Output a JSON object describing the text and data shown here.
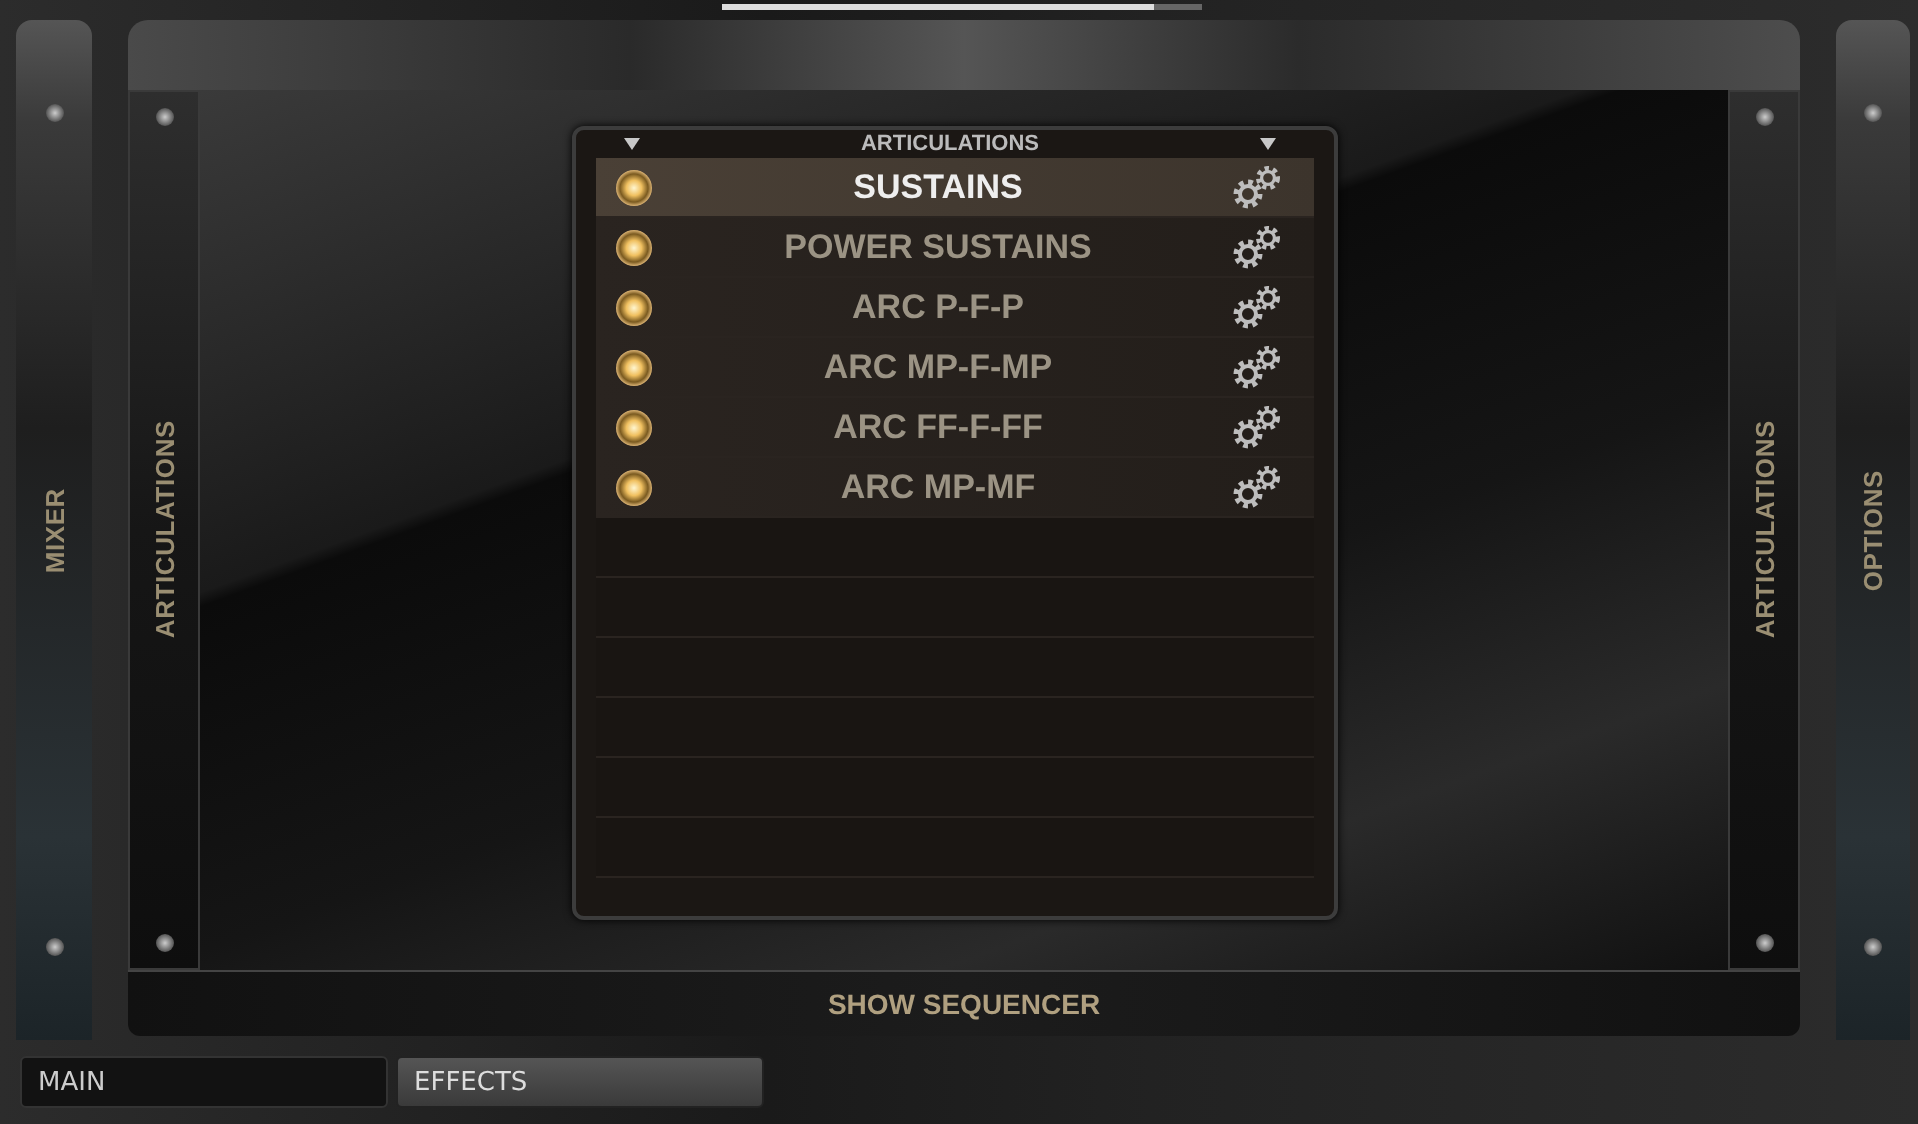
{
  "left_tab": {
    "label": "MIXER"
  },
  "left_panel": {
    "label": "ARTICULATIONS"
  },
  "articulations": {
    "title": "ARTICULATIONS",
    "items": [
      {
        "label": "SUSTAINS",
        "selected": true
      },
      {
        "label": "POWER SUSTAINS",
        "selected": false
      },
      {
        "label": "ARC P-F-P",
        "selected": false
      },
      {
        "label": "ARC MP-F-MP",
        "selected": false
      },
      {
        "label": "ARC FF-F-FF",
        "selected": false
      },
      {
        "label": "ARC MP-MF",
        "selected": false
      }
    ]
  },
  "right_panel": {
    "label": "ARTICULATIONS"
  },
  "right_tab": {
    "label": "OPTIONS"
  },
  "sequencer_button": {
    "label": "SHOW SEQUENCER"
  },
  "tabs": [
    {
      "label": "MAIN",
      "selected": true
    },
    {
      "label": "EFFECTS",
      "selected": false
    }
  ]
}
